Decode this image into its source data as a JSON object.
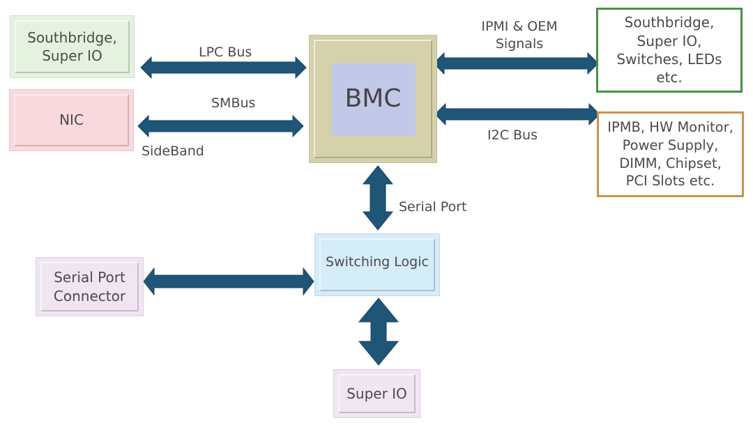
{
  "diagram": {
    "nodes": {
      "southbridge_left": {
        "label": "Southbridge,\nSuper IO",
        "fill": "#e6f2e0",
        "border": "#c9dcc0"
      },
      "nic": {
        "label": "NIC",
        "fill": "#f9d9de",
        "border": "#e7b9c1"
      },
      "bmc": {
        "label": "BMC",
        "fill": "#d4d1ab",
        "inner_fill": "#c2c8e8"
      },
      "southbridge_right": {
        "label": "Southbridge,\nSuper IO,\nSwitches, LEDs\netc.",
        "fill": "#ffffff",
        "border": "#4a9144"
      },
      "ipmb": {
        "label": "IPMB, HW Monitor,\nPower Supply,\nDIMM, Chipset,\nPCI Slots etc.",
        "fill": "#ffffff",
        "border": "#c9944a"
      },
      "switching_logic": {
        "label": "Switching Logic",
        "fill": "#d5ecf9",
        "border": "#b8d6e8"
      },
      "serial_port_connector": {
        "label": "Serial Port\nConnector",
        "fill": "#efe6f2",
        "border": "#d6c9da"
      },
      "super_io_bottom": {
        "label": "Super IO",
        "fill": "#efe6f2",
        "border": "#d6c9da"
      }
    },
    "edges": {
      "lpc_bus": {
        "label": "LPC Bus",
        "from": "southbridge_left",
        "to": "bmc"
      },
      "smbus": {
        "label": "SMBus",
        "sublabel": "SideBand",
        "from": "nic",
        "to": "bmc"
      },
      "ipmi_oem": {
        "label": "IPMI & OEM\nSignals",
        "from": "bmc",
        "to": "southbridge_right"
      },
      "i2c_bus": {
        "label": "I2C Bus",
        "from": "bmc",
        "to": "ipmb"
      },
      "serial_port": {
        "label": "Serial Port",
        "from": "bmc",
        "to": "switching_logic"
      },
      "serial_connector_link": {
        "label": "",
        "from": "serial_port_connector",
        "to": "switching_logic"
      },
      "super_io_link": {
        "label": "",
        "from": "switching_logic",
        "to": "super_io_bottom"
      }
    },
    "arrow_color": "#1f5577"
  }
}
